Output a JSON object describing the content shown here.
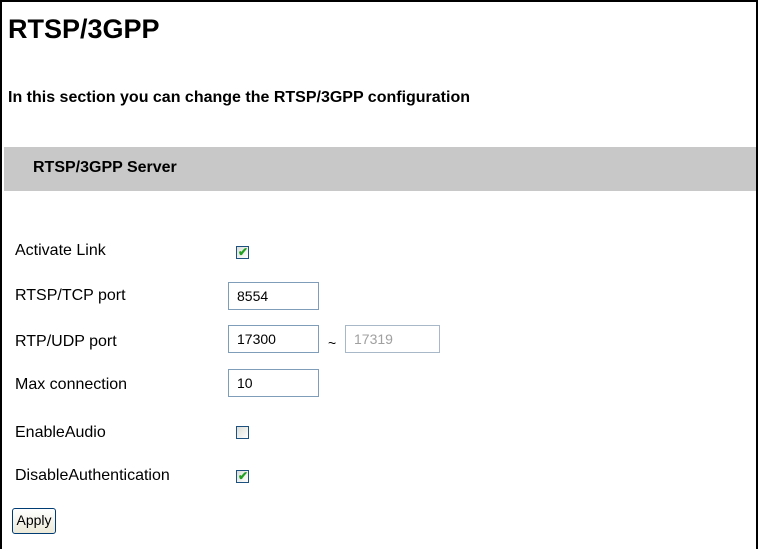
{
  "page": {
    "title": "RTSP/3GPP",
    "subtitle": "In this section you can change the RTSP/3GPP configuration",
    "section_title": "RTSP/3GPP Server"
  },
  "form": {
    "activate_link": {
      "label": "Activate Link",
      "checked": true
    },
    "rtsp_tcp_port": {
      "label": "RTSP/TCP port",
      "value": "8554"
    },
    "rtp_udp_port": {
      "label": "RTP/UDP port",
      "value": "17300",
      "separator": "~",
      "end_value": "17319"
    },
    "max_connection": {
      "label": "Max connection",
      "value": "10"
    },
    "enable_audio": {
      "label": "EnableAudio",
      "checked": false
    },
    "disable_authentication": {
      "label": "DisableAuthentication",
      "checked": true
    },
    "apply_label": "Apply",
    "check_glyph": "✔"
  },
  "colors": {
    "section_bar": "#c8c8c8",
    "checkmark": "#21a121"
  }
}
